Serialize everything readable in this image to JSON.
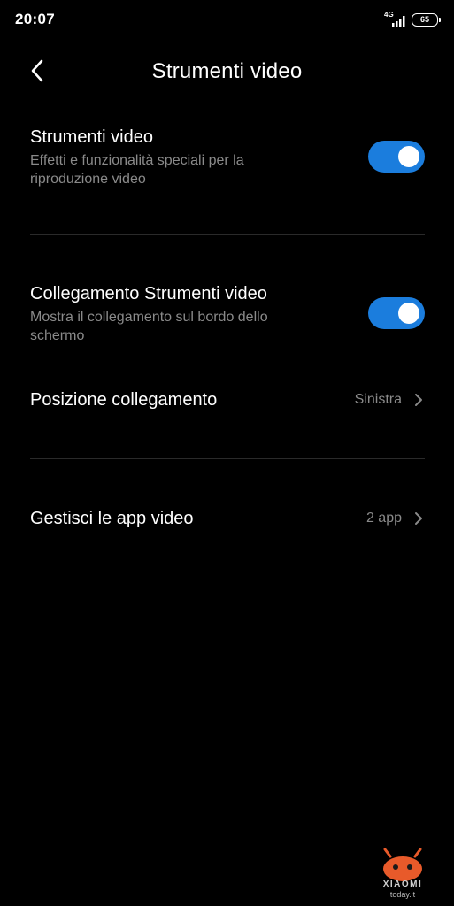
{
  "status_bar": {
    "time": "20:07",
    "network_type": "4G",
    "network_sub": "..ll",
    "battery_level": "65"
  },
  "header": {
    "title": "Strumenti video",
    "back_icon": "chevron-left-icon"
  },
  "settings": {
    "video_tools": {
      "title": "Strumenti video",
      "description": "Effetti e funzionalità speciali per la riproduzione video",
      "enabled": true
    },
    "video_tools_link": {
      "title": "Collegamento Strumenti video",
      "description": "Mostra il collegamento sul bordo dello schermo",
      "enabled": true
    },
    "link_position": {
      "label": "Posizione collegamento",
      "value": "Sinistra"
    },
    "manage_video_apps": {
      "label": "Gestisci le app video",
      "value": "2 app"
    }
  },
  "watermark": {
    "brand": "XIAOMI",
    "sub": "today.it"
  },
  "colors": {
    "background": "#000000",
    "accent": "#1b7ddd",
    "secondary_text": "#8a8a8a",
    "divider": "#2a2a2a"
  }
}
